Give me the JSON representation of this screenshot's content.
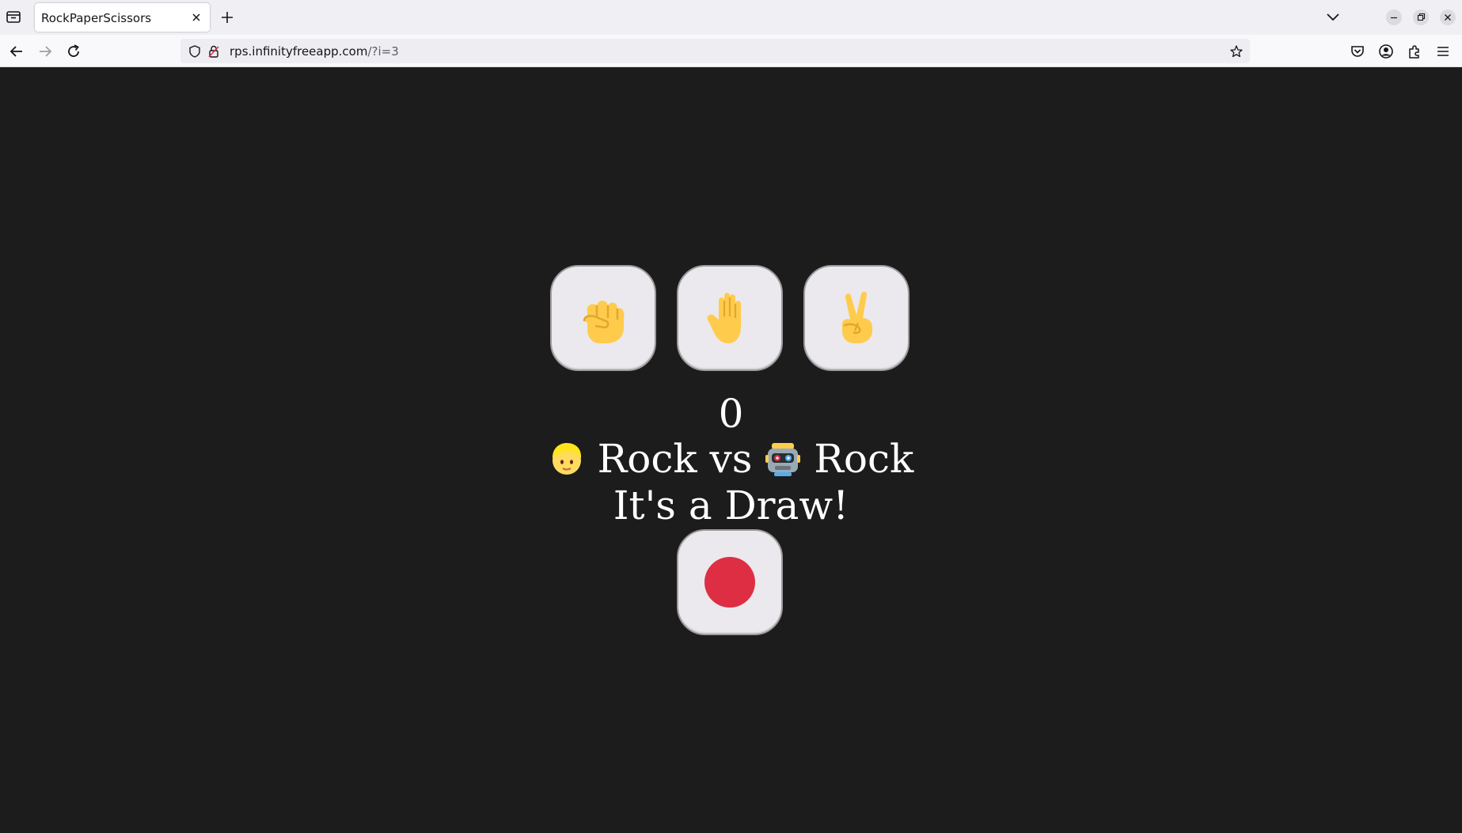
{
  "browser": {
    "tab_title": "RockPaperScissors",
    "url_host": "rps.infinityfreeapp.com",
    "url_path": "/?i=3"
  },
  "game": {
    "choices": [
      "rock",
      "paper",
      "scissors"
    ],
    "score": "0",
    "player_choice": "Rock",
    "vs_label": "vs",
    "computer_choice": "Rock",
    "result": "It's a Draw!",
    "reset_color": "#dd2e44"
  },
  "icons": {
    "player": "blond-person-emoji",
    "computer": "robot-emoji",
    "rock": "raised-fist-emoji",
    "paper": "raised-hand-emoji",
    "scissors": "victory-hand-emoji",
    "reset": "red-circle-emoji"
  }
}
